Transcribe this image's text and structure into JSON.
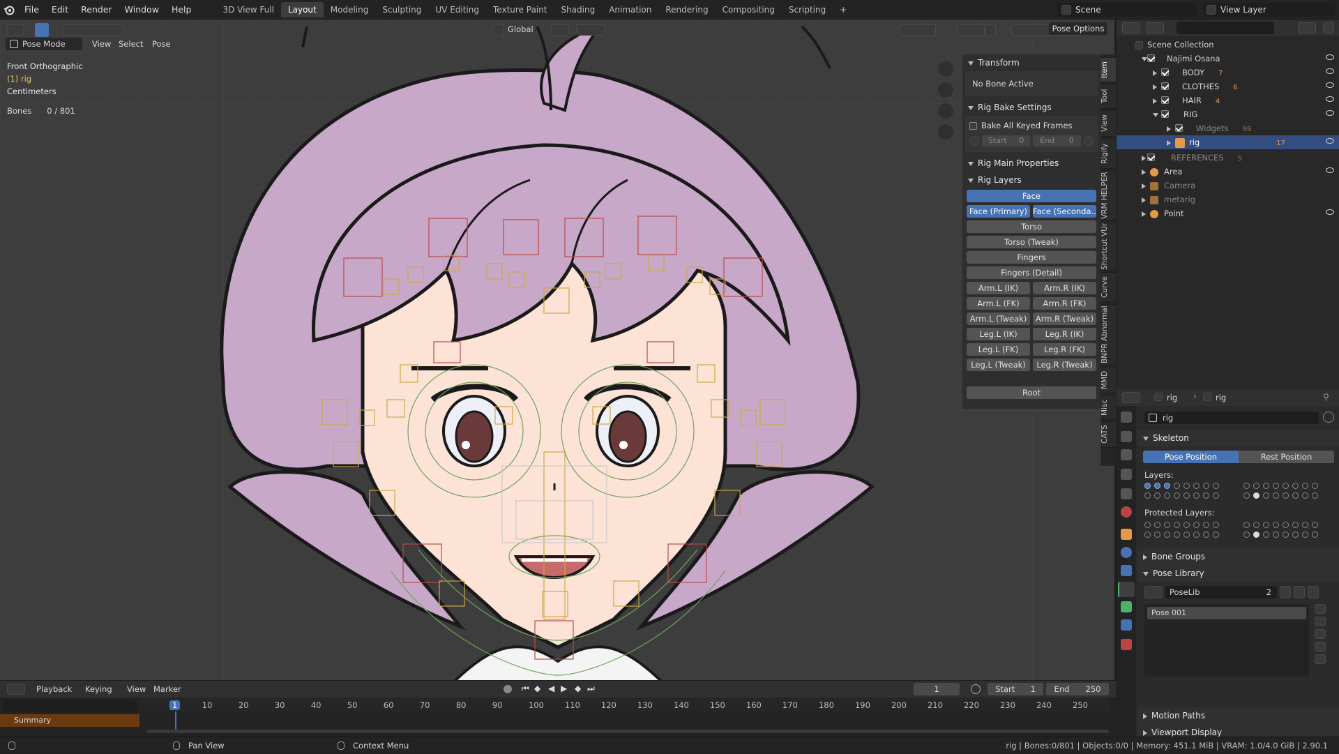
{
  "topbar": {
    "menus": [
      "File",
      "Edit",
      "Render",
      "Window",
      "Help"
    ],
    "workspaces": [
      "3D View Full",
      "Layout",
      "Modeling",
      "Sculpting",
      "UV Editing",
      "Texture Paint",
      "Shading",
      "Animation",
      "Rendering",
      "Compositing",
      "Scripting"
    ],
    "active_workspace": "Layout",
    "add_tab": "+",
    "scene_name": "Scene",
    "view_layer": "View Layer"
  },
  "viewport_header": {
    "mode": "Pose Mode",
    "menus": [
      "View",
      "Select",
      "Pose"
    ],
    "orientation": "Global",
    "pose_options": "Pose Options"
  },
  "viewport_overlay": {
    "view_name": "Front Orthographic",
    "object_line": "(1) rig",
    "units": "Centimeters",
    "bones_label": "Bones",
    "bones_value": "0 / 801"
  },
  "n_panel": {
    "transform_title": "Transform",
    "no_bone": "No Bone Active",
    "bake_title": "Rig Bake Settings",
    "bake_all": "Bake All Keyed Frames",
    "start_label": "Start",
    "start_value": "0",
    "end_label": "End",
    "end_value": "0",
    "main_props_title": "Rig Main Properties",
    "layers_title": "Rig Layers",
    "face": "Face",
    "face_primary": "Face (Primary)",
    "face_secondary": "Face (Seconda...",
    "torso": "Torso",
    "torso_tweak": "Torso (Tweak)",
    "fingers": "Fingers",
    "fingers_detail": "Fingers (Detail)",
    "arm_l_ik": "Arm.L (IK)",
    "arm_r_ik": "Arm.R (IK)",
    "arm_l_fk": "Arm.L (FK)",
    "arm_r_fk": "Arm.R (FK)",
    "arm_l_tweak": "Arm.L (Tweak)",
    "arm_r_tweak": "Arm.R (Tweak)",
    "leg_l_ik": "Leg.L (IK)",
    "leg_r_ik": "Leg.R (IK)",
    "leg_l_fk": "Leg.L (FK)",
    "leg_r_fk": "Leg.R (FK)",
    "leg_l_tweak": "Leg.L (Tweak)",
    "leg_r_tweak": "Leg.R (Tweak)",
    "root": "Root"
  },
  "side_tabs": [
    "Item",
    "Tool",
    "View",
    "Rigify",
    "VRM HELPER",
    "Shortcut VUr",
    "Curve",
    "BNPR Abnormal",
    "MMD",
    "Misc",
    "CATS"
  ],
  "outliner": {
    "root": "Scene Collection",
    "collection": "Najimi Osana",
    "body": "BODY",
    "clothes": "CLOTHES",
    "hair": "HAIR",
    "rig_coll": "RIG",
    "widgets": "Widgets",
    "rig": "rig",
    "references": "REFERENCES",
    "area": "Area",
    "camera": "Camera",
    "metarig": "metarig",
    "point": "Point",
    "badge_body": "7",
    "badge_clothes": "6",
    "badge_hair": "4",
    "badge_widgets": "99",
    "badge_rig": "17",
    "badge_refs": "5"
  },
  "properties": {
    "breadcrumb_a": "rig",
    "breadcrumb_b": "rig",
    "data_name": "rig",
    "skeleton_title": "Skeleton",
    "pose_position": "Pose Position",
    "rest_position": "Rest Position",
    "layers_label": "Layers:",
    "protected_label": "Protected Layers:",
    "bone_groups": "Bone Groups",
    "pose_library": "Pose Library",
    "poselib_name": "PoseLib",
    "poselib_users": "2",
    "pose_item": "Pose 001",
    "motion_paths": "Motion Paths",
    "viewport_display": "Viewport Display"
  },
  "timeline": {
    "menus": [
      "Playback",
      "Keying",
      "View",
      "Marker"
    ],
    "current_frame": "1",
    "start_label": "Start",
    "start_value": "1",
    "end_label": "End",
    "end_value": "250",
    "ticks": [
      "1",
      "10",
      "20",
      "30",
      "40",
      "50",
      "60",
      "70",
      "80",
      "90",
      "100",
      "110",
      "120",
      "130",
      "140",
      "150",
      "160",
      "170",
      "180",
      "190",
      "200",
      "210",
      "220",
      "230",
      "240",
      "250"
    ],
    "summary": "Summary"
  },
  "statusbar": {
    "pan": "Pan View",
    "context": "Context Menu",
    "stats": "rig | Bones:0/801 | Objects:0/0 | Memory: 451.1 MiB | VRAM: 1.0/4.0 GiB | 2.90.1"
  },
  "colors": {
    "accent": "#4772b3",
    "hair": "#c8a8c8",
    "skin": "#fde3d6",
    "outline": "#1a1a1a",
    "timeline_summary": "#6b3a10"
  }
}
